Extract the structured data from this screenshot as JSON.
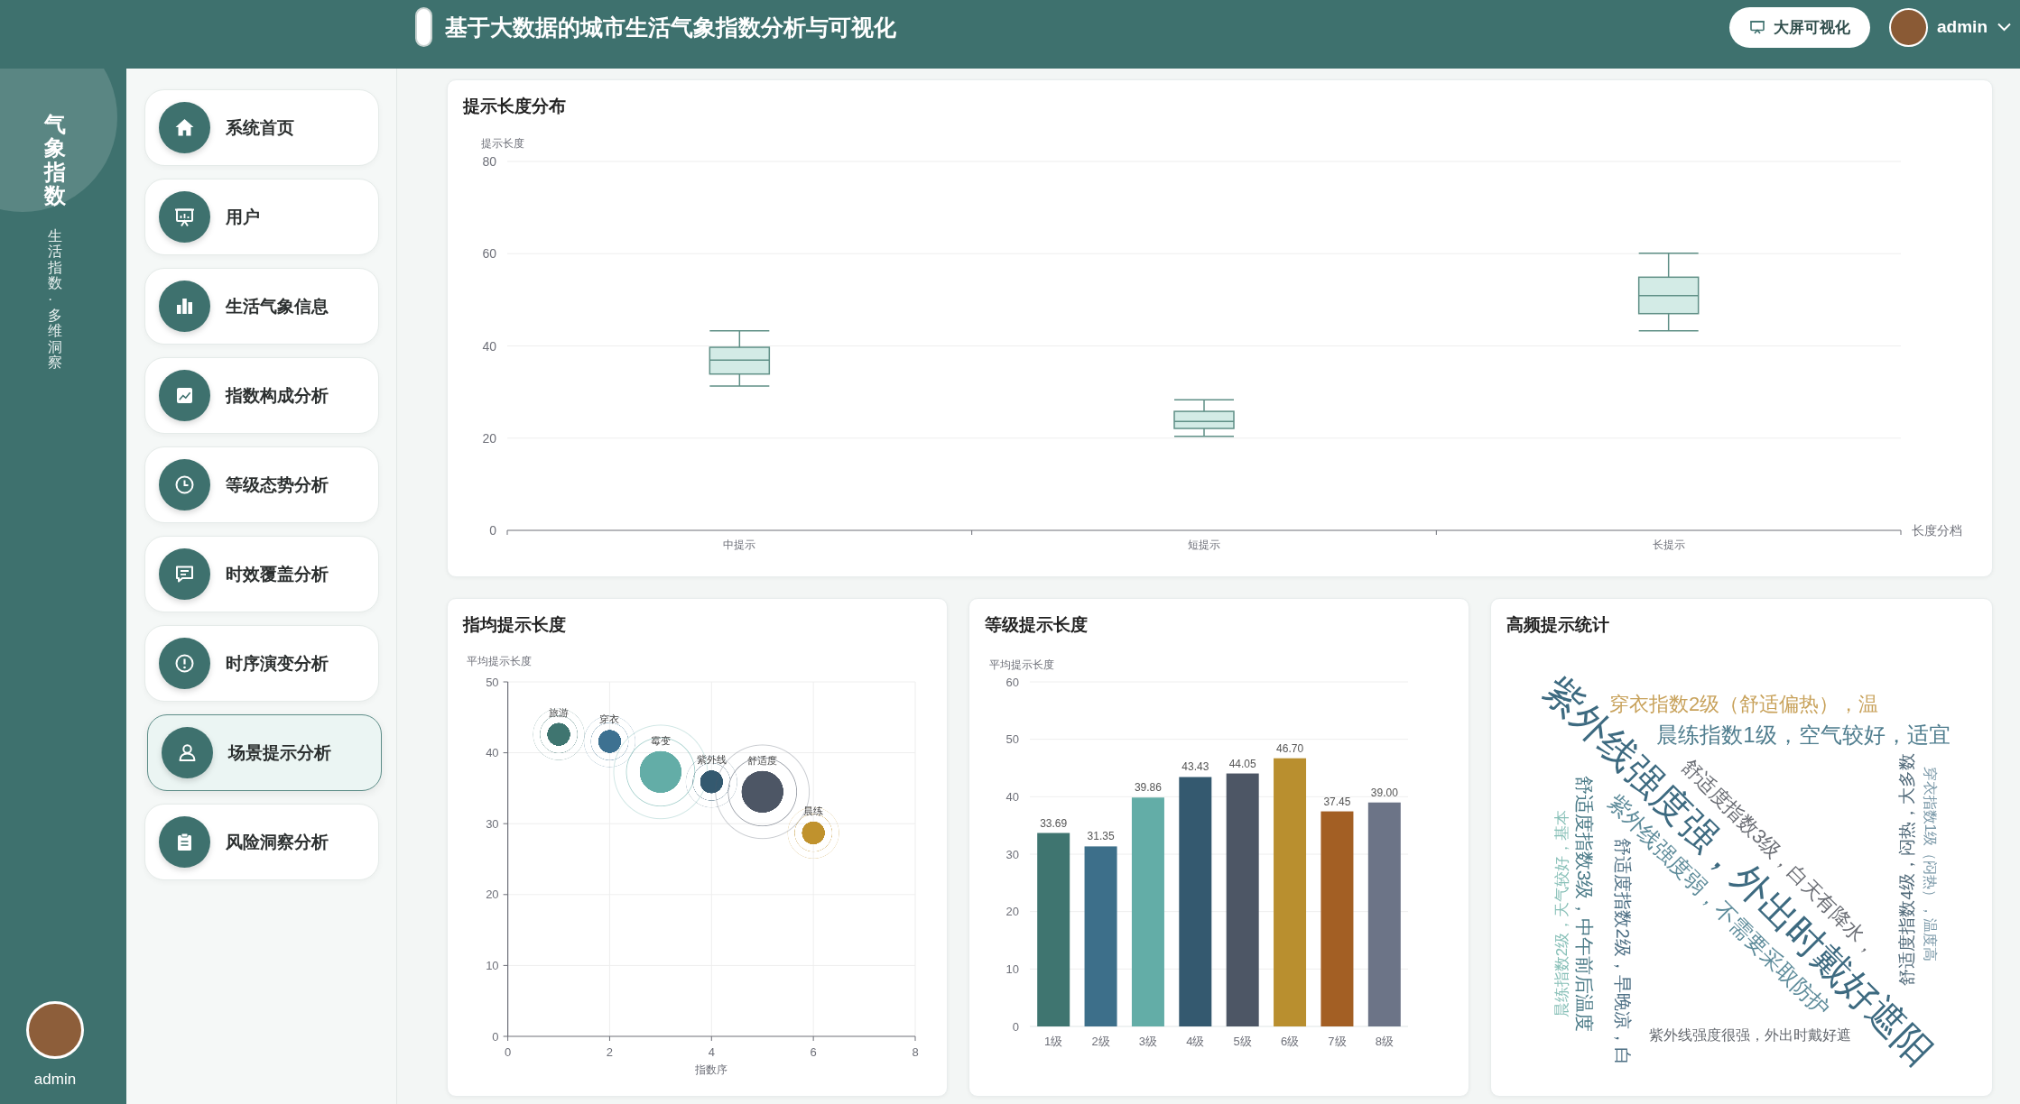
{
  "header": {
    "title": "基于大数据的城市生活气象指数分析与可视化",
    "button": {
      "label": "大屏可视化"
    },
    "user": {
      "name": "admin"
    }
  },
  "rail": {
    "title": "气象指数",
    "subtitle": "生活指数·多维洞察",
    "user": {
      "name": "admin"
    }
  },
  "sidebar": {
    "items": [
      {
        "label": "系统首页",
        "selected": false
      },
      {
        "label": "用户",
        "selected": false
      },
      {
        "label": "生活气象信息",
        "selected": false
      },
      {
        "label": "指数构成分析",
        "selected": false
      },
      {
        "label": "等级态势分析",
        "selected": false
      },
      {
        "label": "时效覆盖分析",
        "selected": false
      },
      {
        "label": "时序演变分析",
        "selected": false
      },
      {
        "label": "场景提示分析",
        "selected": true
      },
      {
        "label": "风险洞察分析",
        "selected": false
      }
    ]
  },
  "length_distribution": {
    "title": "提示长度分布",
    "chart_data": {
      "type": "box",
      "xlabel": "长度分档",
      "ylabel": "提示长度",
      "categories": [
        "中提示",
        "短提示",
        "长提示"
      ],
      "boxes": [
        {
          "low": 31.3,
          "q1": 33.9,
          "median": 36.9,
          "q3": 39.7,
          "high": 43.3
        },
        {
          "low": 20.4,
          "q1": 22.1,
          "median": 23.6,
          "q3": 25.8,
          "high": 28.3
        },
        {
          "low": 43.3,
          "q1": 47.0,
          "median": 50.9,
          "q3": 54.9,
          "high": 60.1
        }
      ],
      "ylim": [
        0,
        80
      ],
      "yticks": [
        0,
        20,
        40,
        60,
        80
      ],
      "grid": true
    }
  },
  "index_average_length": {
    "title": "指均提示长度",
    "chart_data": {
      "type": "bubble",
      "xlabel": "指数序",
      "ylabel": "平均提示长度",
      "x": [
        1,
        2,
        3,
        4,
        5,
        6
      ],
      "values": [
        42.6,
        41.6,
        37.3,
        35.9,
        34.5,
        28.7
      ],
      "sizes": [
        0.3,
        0.3,
        1,
        0.3,
        1,
        0.3
      ],
      "colors": [
        "#3f7570",
        "#3d7191",
        "#63ada7",
        "#34596f",
        "#4d5665",
        "#c0922d"
      ],
      "value_labels": [
        "旅游",
        "穿衣",
        "霉变",
        "紫外线",
        "舒适度",
        "晨练"
      ],
      "xlim": [
        0,
        8
      ],
      "ylim": [
        0,
        50
      ],
      "xticks": [
        0,
        2,
        4,
        6,
        8
      ],
      "yticks": [
        0,
        10,
        20,
        30,
        40,
        50
      ],
      "grid": true
    }
  },
  "level_average_length": {
    "title": "等级提示长度",
    "chart_data": {
      "type": "bar",
      "ylabel": "平均提示长度",
      "categories": [
        "1级",
        "2级",
        "3级",
        "4级",
        "5级",
        "6级",
        "7级",
        "8级"
      ],
      "values": [
        33.69,
        31.35,
        39.86,
        43.43,
        44.05,
        46.7,
        37.45,
        39.0
      ],
      "colors": [
        "#3f7570",
        "#3d6f8a",
        "#63ada7",
        "#34596f",
        "#4d5665",
        "#b98f2f",
        "#a35f24",
        "#6c7487"
      ],
      "ylim": [
        0,
        60
      ],
      "yticks": [
        0,
        10,
        20,
        30,
        40,
        50,
        60
      ],
      "value_labels": [
        "33.69",
        "31.35",
        "39.86",
        "43.43",
        "44.05",
        "46.70",
        "37.45",
        "39.00"
      ],
      "grid": true
    }
  },
  "frequent_hints": {
    "title": "高频提示统计",
    "words": [
      {
        "text": "紫外线强度强，外出时戴好遮阳",
        "color": "#3d6a80",
        "kind": "diagonal"
      },
      {
        "text": "穿衣指数2级（舒适偏热），温",
        "color": "#c8a25b",
        "kind": "horizontal"
      },
      {
        "text": "晨练指数1级，空气较好，适宜",
        "color": "#4f7d8e",
        "kind": "horizontal"
      },
      {
        "text": "舒适度指数3级，白天有降水，",
        "color": "#6b6e75",
        "kind": "diagonal"
      },
      {
        "text": "紫外线强度弱，不需要采取防护",
        "color": "#5d8b9a",
        "kind": "diagonal"
      },
      {
        "text": "舒适度指数3级，中午前后温度",
        "color": "#4a7a87",
        "kind": "down"
      },
      {
        "text": "晨练指数2级，天气较好，基本",
        "color": "#88c0b8",
        "kind": "up"
      },
      {
        "text": "舒适度指数2级，早晚凉，白",
        "color": "#4d6f84",
        "kind": "down"
      },
      {
        "text": "舒适度指数4级，闷热，大多数",
        "color": "#4f6878",
        "kind": "up"
      },
      {
        "text": "穿衣指数1级（闷热），温度高",
        "color": "#7a98a8",
        "kind": "down"
      },
      {
        "text": "紫外线强度很强，外出时戴好遮",
        "color": "#666a70",
        "kind": "horizontal"
      }
    ]
  }
}
